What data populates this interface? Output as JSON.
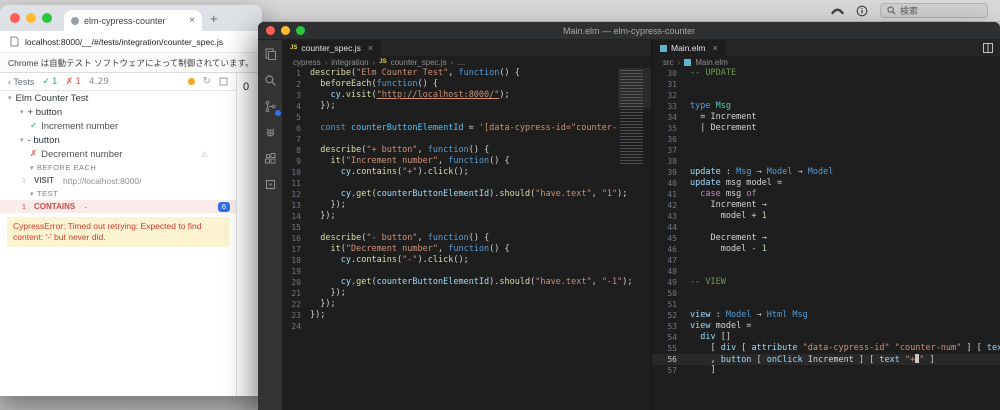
{
  "menubar": {
    "search_placeholder": "検索",
    "icons": [
      "phone-icon",
      "info-icon",
      "search-icon"
    ]
  },
  "chrome": {
    "tab_title": "elm-cypress-counter",
    "url": "localhost:8000/__/#/tests/integration/counter_spec.js",
    "infobar_text": "Chrome は自動テスト ソフトウェアによって制御されています。",
    "preview_counter": "0"
  },
  "cypress": {
    "header": {
      "back": "Tests",
      "passed": "1",
      "failed": "1",
      "duration": "4.29"
    },
    "suite": "Elm Counter Test",
    "group_plus": "+ button",
    "test_pass": "Increment number",
    "group_minus": "- button",
    "test_fail": "Decrement number",
    "before_each_label": "BEFORE EACH",
    "test_label": "TEST",
    "visit_cmd": {
      "index": "1",
      "name": "VISIT",
      "message": "http://localhost:8000/"
    },
    "contains_cmd": {
      "index": "1",
      "name": "CONTAINS",
      "message": "-",
      "badge": "6"
    },
    "error": "CypressError: Timed out retrying: Expected to find content: '-' but never did.",
    "colors": {
      "pass": "#1fa971",
      "fail": "#e45649",
      "badge": "#2f6fe8",
      "error_bg": "#fcf4d1"
    }
  },
  "vscode": {
    "window_title": "Main.elm — elm-cypress-counter",
    "activity_icons": [
      "explorer-icon",
      "search-icon",
      "source-control-icon",
      "debug-icon",
      "extensions-icon",
      "remote-icon"
    ],
    "left_editor": {
      "tab": "counter_spec.js",
      "tab_icon": "JS",
      "breadcrumb": [
        "cypress",
        "integration",
        "counter_spec.js",
        "…"
      ],
      "code": {
        "start": 1,
        "lines": [
          [
            [
              "fn",
              "describe"
            ],
            [
              "pl",
              "("
            ],
            [
              "str",
              "\"Elm Counter Test\""
            ],
            [
              "pl",
              ", "
            ],
            [
              "kw",
              "function"
            ],
            [
              "pl",
              "() {"
            ]
          ],
          [
            [
              "pl",
              "  "
            ],
            [
              "fn",
              "beforeEach"
            ],
            [
              "pl",
              "("
            ],
            [
              "kw",
              "function"
            ],
            [
              "pl",
              "() {"
            ]
          ],
          [
            [
              "pl",
              "    "
            ],
            [
              "var",
              "cy"
            ],
            [
              "pl",
              "."
            ],
            [
              "fn",
              "visit"
            ],
            [
              "pl",
              "("
            ],
            [
              "lnk",
              "\"http://localhost:8000/\""
            ],
            [
              "pl",
              ");"
            ]
          ],
          [
            [
              "pl",
              "  });"
            ]
          ],
          [],
          [
            [
              "pl",
              "  "
            ],
            [
              "kw",
              "const"
            ],
            [
              "pl",
              " "
            ],
            [
              "cst",
              "counterButtonElementId"
            ],
            [
              "pl",
              " = "
            ],
            [
              "str",
              "'[data-cypress-id=\"counter-num"
            ]
          ],
          [],
          [
            [
              "pl",
              "  "
            ],
            [
              "fn",
              "describe"
            ],
            [
              "pl",
              "("
            ],
            [
              "str",
              "\"+ button\""
            ],
            [
              "pl",
              ", "
            ],
            [
              "kw",
              "function"
            ],
            [
              "pl",
              "() {"
            ]
          ],
          [
            [
              "pl",
              "    "
            ],
            [
              "fn",
              "it"
            ],
            [
              "pl",
              "("
            ],
            [
              "str",
              "\"Increment number\""
            ],
            [
              "pl",
              ", "
            ],
            [
              "kw",
              "function"
            ],
            [
              "pl",
              "() {"
            ]
          ],
          [
            [
              "pl",
              "      "
            ],
            [
              "var",
              "cy"
            ],
            [
              "pl",
              "."
            ],
            [
              "fn",
              "contains"
            ],
            [
              "pl",
              "("
            ],
            [
              "str",
              "\"+\""
            ],
            [
              "pl",
              ")."
            ],
            [
              "fn",
              "click"
            ],
            [
              "pl",
              "();"
            ]
          ],
          [],
          [
            [
              "pl",
              "      "
            ],
            [
              "var",
              "cy"
            ],
            [
              "pl",
              "."
            ],
            [
              "fn",
              "get"
            ],
            [
              "pl",
              "("
            ],
            [
              "var",
              "counterButtonElementId"
            ],
            [
              "pl",
              ")."
            ],
            [
              "fn",
              "should"
            ],
            [
              "pl",
              "("
            ],
            [
              "str",
              "\"have.text\""
            ],
            [
              "pl",
              ", "
            ],
            [
              "str",
              "\"1\""
            ],
            [
              "pl",
              ");"
            ]
          ],
          [
            [
              "pl",
              "    });"
            ]
          ],
          [
            [
              "pl",
              "  });"
            ]
          ],
          [],
          [
            [
              "pl",
              "  "
            ],
            [
              "fn",
              "describe"
            ],
            [
              "pl",
              "("
            ],
            [
              "str",
              "\"- button\""
            ],
            [
              "pl",
              ", "
            ],
            [
              "kw",
              "function"
            ],
            [
              "pl",
              "() {"
            ]
          ],
          [
            [
              "pl",
              "    "
            ],
            [
              "fn",
              "it"
            ],
            [
              "pl",
              "("
            ],
            [
              "str",
              "\"Decrement number\""
            ],
            [
              "pl",
              ", "
            ],
            [
              "kw",
              "function"
            ],
            [
              "pl",
              "() {"
            ]
          ],
          [
            [
              "pl",
              "      "
            ],
            [
              "var",
              "cy"
            ],
            [
              "pl",
              "."
            ],
            [
              "fn",
              "contains"
            ],
            [
              "pl",
              "("
            ],
            [
              "str",
              "\"-\""
            ],
            [
              "pl",
              ")."
            ],
            [
              "fn",
              "click"
            ],
            [
              "pl",
              "();"
            ]
          ],
          [],
          [
            [
              "pl",
              "      "
            ],
            [
              "var",
              "cy"
            ],
            [
              "pl",
              "."
            ],
            [
              "fn",
              "get"
            ],
            [
              "pl",
              "("
            ],
            [
              "var",
              "counterButtonElementId"
            ],
            [
              "pl",
              ")."
            ],
            [
              "fn",
              "should"
            ],
            [
              "pl",
              "("
            ],
            [
              "str",
              "\"have.text\""
            ],
            [
              "pl",
              ", "
            ],
            [
              "str",
              "\"-1\""
            ],
            [
              "pl",
              ");"
            ]
          ],
          [
            [
              "pl",
              "    });"
            ]
          ],
          [
            [
              "pl",
              "  });"
            ]
          ],
          [
            [
              "pl",
              "});"
            ]
          ],
          []
        ]
      }
    },
    "right_editor": {
      "tab": "Main.elm",
      "breadcrumb": [
        "src",
        "Main.elm"
      ],
      "code": {
        "start": 30,
        "active": 56,
        "lines": [
          [
            [
              "cmt",
              "-- UPDATE"
            ]
          ],
          [],
          [],
          [
            [
              "kw",
              "type"
            ],
            [
              "pl",
              " "
            ],
            [
              "typ",
              "Msg"
            ]
          ],
          [
            [
              "pl",
              "  = Increment"
            ]
          ],
          [
            [
              "pl",
              "  | Decrement"
            ]
          ],
          [],
          [],
          [],
          [
            [
              "var",
              "update"
            ],
            [
              "pl",
              " : "
            ],
            [
              "kw",
              "Msg"
            ],
            [
              "pl",
              " → "
            ],
            [
              "kw",
              "Model"
            ],
            [
              "pl",
              " → "
            ],
            [
              "kw",
              "Model"
            ]
          ],
          [
            [
              "var",
              "update"
            ],
            [
              "pl",
              " msg model ="
            ]
          ],
          [
            [
              "pl",
              "  "
            ],
            [
              "ctl",
              "case"
            ],
            [
              "pl",
              " msg "
            ],
            [
              "ctl",
              "of"
            ]
          ],
          [
            [
              "pl",
              "    Increment →"
            ]
          ],
          [
            [
              "pl",
              "      model + "
            ],
            [
              "num",
              "1"
            ]
          ],
          [],
          [
            [
              "pl",
              "    Decrement →"
            ]
          ],
          [
            [
              "pl",
              "      model - "
            ],
            [
              "num",
              "1"
            ]
          ],
          [],
          [],
          [
            [
              "cmt",
              "-- VIEW"
            ]
          ],
          [],
          [],
          [
            [
              "var",
              "view"
            ],
            [
              "pl",
              " : "
            ],
            [
              "kw",
              "Model"
            ],
            [
              "pl",
              " → "
            ],
            [
              "kw",
              "Html"
            ],
            [
              "pl",
              " "
            ],
            [
              "kw",
              "Msg"
            ]
          ],
          [
            [
              "var",
              "view"
            ],
            [
              "pl",
              " model ="
            ]
          ],
          [
            [
              "pl",
              "  "
            ],
            [
              "var",
              "div"
            ],
            [
              "pl",
              " []"
            ]
          ],
          [
            [
              "pl",
              "    [ "
            ],
            [
              "var",
              "div"
            ],
            [
              "pl",
              " [ "
            ],
            [
              "var",
              "attribute"
            ],
            [
              "pl",
              " "
            ],
            [
              "str",
              "\"data-cypress-id\""
            ],
            [
              "pl",
              " "
            ],
            [
              "str",
              "\"counter-num\""
            ],
            [
              "pl",
              " ] [ "
            ],
            [
              "var",
              "text"
            ],
            [
              "pl",
              " ("
            ]
          ],
          [
            [
              "pl",
              "    , "
            ],
            [
              "var",
              "button"
            ],
            [
              "pl",
              " [ "
            ],
            [
              "var",
              "onClick"
            ],
            [
              "pl",
              " Increment ] [ "
            ],
            [
              "var",
              "text"
            ],
            [
              "pl",
              " "
            ],
            [
              "str",
              "\"+"
            ],
            [
              "cur",
              ""
            ],
            [
              "str",
              "\""
            ],
            [
              "pl",
              " ]"
            ]
          ],
          [
            [
              "pl",
              "    ]"
            ]
          ]
        ]
      }
    }
  }
}
